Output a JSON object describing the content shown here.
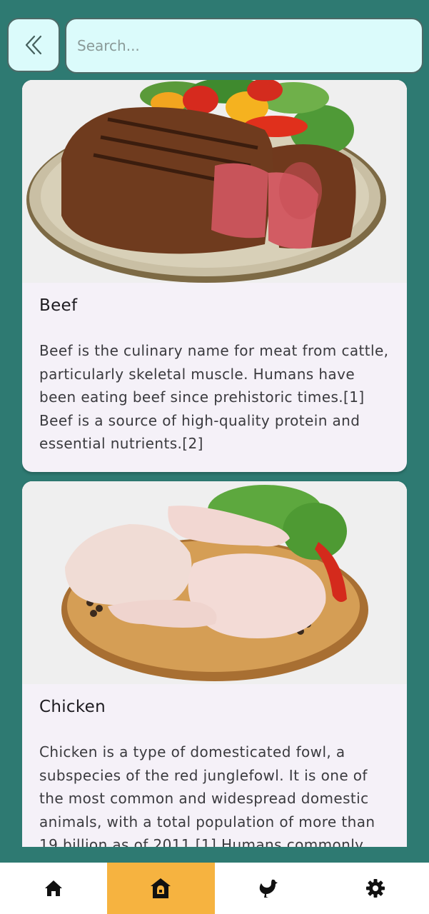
{
  "header": {
    "back_icon": "double-chevron-left-icon",
    "search_placeholder": "Search..."
  },
  "cards": [
    {
      "title": "Beef",
      "image": "steak-on-plate-photo",
      "description": "Beef is the culinary name for meat from cattle, particularly skeletal muscle. Humans have been eating beef since prehistoric times.[1] Beef is a source of high-quality protein and essential nutrients.[2]"
    },
    {
      "title": "Chicken",
      "image": "raw-chicken-legs-on-board-photo",
      "description": "Chicken is a type of domesticated fowl, a subspecies of the red junglefowl. It is one of the most common and widespread domestic animals, with a total population of more than 19 billion as of 2011.[1] Humans commonly"
    }
  ],
  "bottom_nav": {
    "items": [
      {
        "icon": "home-icon",
        "active": false
      },
      {
        "icon": "farm-house-icon",
        "active": true
      },
      {
        "icon": "bird-icon",
        "active": false
      },
      {
        "icon": "gear-icon",
        "active": false
      }
    ]
  },
  "colors": {
    "background": "#2e7a72",
    "field_bg": "#dbfbfb",
    "card_bg": "#f5f1f8",
    "active_nav": "#f6b340"
  }
}
